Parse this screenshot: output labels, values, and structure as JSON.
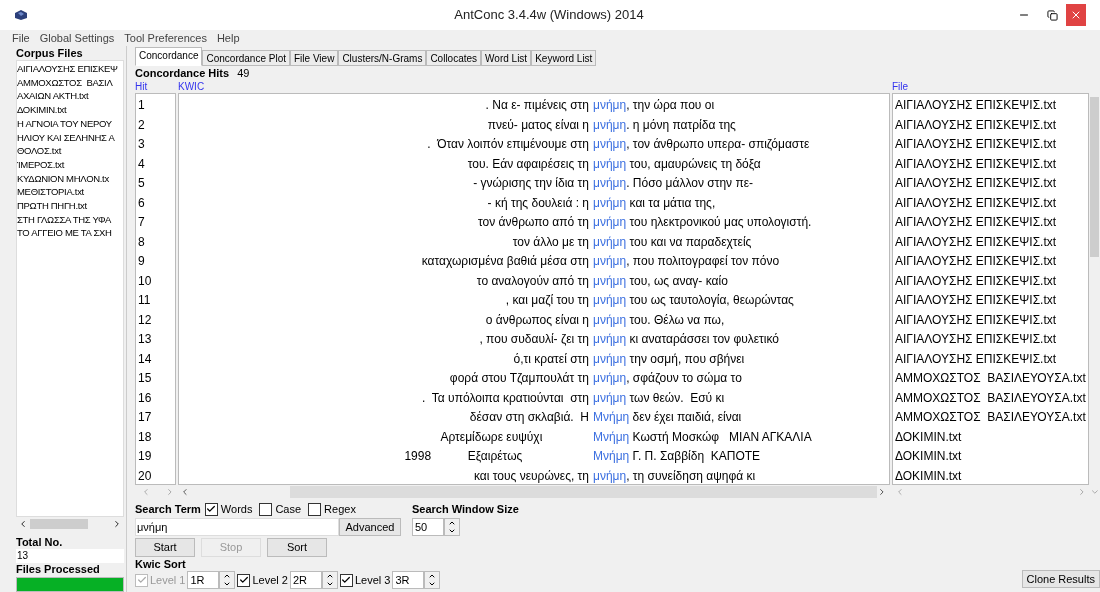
{
  "window": {
    "title": "AntConc 3.4.4w (Windows) 2014"
  },
  "menu": [
    "File",
    "Global Settings",
    "Tool Preferences",
    "Help"
  ],
  "corpus_files": {
    "label": "Corpus Files",
    "items": [
      "ΑΙΓΙΑΛΟΥΣΗΣ ΕΠΙΣΚΕΨ",
      "ΑΜΜΟΧΩΣΤΟΣ  ΒΑΣΙΛ",
      "ΑΧΑΙΩΝ ΑΚΤΗ.txt",
      "ΔΟΚΙΜΙΝ.txt",
      "Η ΑΓΝΟΙΑ ΤΟΥ ΝΕΡΟΥ",
      "ΗΛΙΟΥ ΚΑΙ ΣΕΛΗΝΗΣ Α",
      "ΘΟΛΟΣ.txt",
      "ΊΜΕΡΟΣ.txt",
      "ΚΥΔΩΝΙΟΝ ΜΗΛΟΝ.tx",
      "ΜΕΘΙΣΤΟΡΙΑ.txt",
      "ΠΡΩΤΗ ΠΗΓΗ.txt",
      "ΣΤΗ ΓΛΩΣΣΑ ΤΗΣ ΥΦΑ",
      "ΤΟ ΑΓΓΕΙΟ ΜΕ ΤΑ ΣΧΗ"
    ],
    "total_label": "Total No.",
    "total": "13",
    "processed_label": "Files Processed",
    "processed": {
      "level": 1
    }
  },
  "tabs": [
    {
      "label": "Concordance",
      "selected": true
    },
    {
      "label": "Concordance Plot",
      "selected": false
    },
    {
      "label": "File View",
      "selected": false
    },
    {
      "label": "Clusters/N-Grams",
      "selected": false
    },
    {
      "label": "Collocates",
      "selected": false
    },
    {
      "label": "Word List",
      "selected": false
    },
    {
      "label": "Keyword List",
      "selected": false
    }
  ],
  "hits": {
    "label": "Concordance Hits",
    "value": "49"
  },
  "columns": [
    "Hit",
    "KWIC",
    "File"
  ],
  "rows": [
    {
      "hit": "1",
      "left": ". Να ε- πιμένεις στη",
      "keyword": "μνήμη",
      "right": ", την ώρα που οι",
      "file": "ΑΙΓΙΑΛΟΥΣΗΣ ΕΠΙΣΚΕΨΙΣ.txt"
    },
    {
      "hit": "2",
      "left": "πνεύ- ματος είναι η",
      "keyword": "μνήμη",
      "right": ". η μόνη πατρίδα της",
      "file": "ΑΙΓΙΑΛΟΥΣΗΣ ΕΠΙΣΚΕΨΙΣ.txt"
    },
    {
      "hit": "3",
      "left": ".  Όταν λοιπόν επιμένουμε στη",
      "keyword": "μνήμη",
      "right": ", τον άνθρωπο υπερα- σπιζόμαστε",
      "file": "ΑΙΓΙΑΛΟΥΣΗΣ ΕΠΙΣΚΕΨΙΣ.txt"
    },
    {
      "hit": "4",
      "left": "του. Εάν αφαιρέσεις τη",
      "keyword": "μνήμη",
      "right": " του, αμαυρώνεις τη δόξα",
      "file": "ΑΙΓΙΑΛΟΥΣΗΣ ΕΠΙΣΚΕΨΙΣ.txt"
    },
    {
      "hit": "5",
      "left": "- γνώρισης την ίδια τη",
      "keyword": "μνήμη",
      "right": ". Πόσο μάλλον στην πε-",
      "file": "ΑΙΓΙΑΛΟΥΣΗΣ ΕΠΙΣΚΕΨΙΣ.txt"
    },
    {
      "hit": "6",
      "left": "- κή της δουλειά : η",
      "keyword": "μνήμη",
      "right": " και τα μάτια της,",
      "file": "ΑΙΓΙΑΛΟΥΣΗΣ ΕΠΙΣΚΕΨΙΣ.txt"
    },
    {
      "hit": "7",
      "left": "τον άνθρωπο από τη",
      "keyword": "μνήμη",
      "right": " του ηλεκτρονικού μας υπολογιστή.",
      "file": "ΑΙΓΙΑΛΟΥΣΗΣ ΕΠΙΣΚΕΨΙΣ.txt"
    },
    {
      "hit": "8",
      "left": "τον άλλο με τη",
      "keyword": "μνήμη",
      "right": " του και να παραδεχτείς",
      "file": "ΑΙΓΙΑΛΟΥΣΗΣ ΕΠΙΣΚΕΨΙΣ.txt"
    },
    {
      "hit": "9",
      "left": "καταχωρισμένα βαθιά μέσα στη",
      "keyword": "μνήμη",
      "right": ", που πολιτογραφεί τον πόνο",
      "file": "ΑΙΓΙΑΛΟΥΣΗΣ ΕΠΙΣΚΕΨΙΣ.txt"
    },
    {
      "hit": "10",
      "left": "το αναλογούν από τη",
      "keyword": "μνήμη",
      "right": " του, ως αναγ- καίο",
      "file": "ΑΙΓΙΑΛΟΥΣΗΣ ΕΠΙΣΚΕΨΙΣ.txt"
    },
    {
      "hit": "11",
      "left": ", και μαζί του τη",
      "keyword": "μνήμη",
      "right": " του ως ταυτολογία, θεωρώντας",
      "file": "ΑΙΓΙΑΛΟΥΣΗΣ ΕΠΙΣΚΕΨΙΣ.txt"
    },
    {
      "hit": "12",
      "left": "ο άνθρωπος είναι η",
      "keyword": "μνήμη",
      "right": " του. Θέλω να πω,",
      "file": "ΑΙΓΙΑΛΟΥΣΗΣ ΕΠΙΣΚΕΨΙΣ.txt"
    },
    {
      "hit": "13",
      "left": ", που συδαυλί- ζει τη",
      "keyword": "μνήμη",
      "right": " κι αναταράσσει τον φυλετικό",
      "file": "ΑΙΓΙΑΛΟΥΣΗΣ ΕΠΙΣΚΕΨΙΣ.txt"
    },
    {
      "hit": "14",
      "left": "ό,τι κρατεί στη",
      "keyword": "μνήμη",
      "right": " την οσμή, που σβήνει",
      "file": "ΑΙΓΙΑΛΟΥΣΗΣ ΕΠΙΣΚΕΨΙΣ.txt"
    },
    {
      "hit": "15",
      "left": "φορά στου Τζαμπουλάτ τη",
      "keyword": "μνήμη",
      "right": ", σφάζουν το σώμα το",
      "file": "ΑΜΜΟΧΩΣΤΟΣ  ΒΑΣΙΛΕΥΟΥΣΑ.txt"
    },
    {
      "hit": "16",
      "left": ".  Τα υπόλοιπα κρατιούνται  στη",
      "keyword": "μνήμη",
      "right": " των θεών.  Εσύ κι",
      "file": "ΑΜΜΟΧΩΣΤΟΣ  ΒΑΣΙΛΕΥΟΥΣΑ.txt"
    },
    {
      "hit": "17",
      "left": "δέσαν στη σκλαβιά.  Η",
      "keyword": "Μνήμη",
      "right": " δεν έχει παιδιά, είναι",
      "file": "ΑΜΜΟΧΩΣΤΟΣ  ΒΑΣΙΛΕΥΟΥΣΑ.txt"
    },
    {
      "hit": "18",
      "left": "Αρτεμίδωρε ευψύχι              ",
      "keyword": "Μνήμη",
      "right": " Κωστή Μοσκώφ   ΜΙΑΝ ΑΓΚΑΛΙΑ",
      "file": "ΔΟΚΙΜΙΝ.txt"
    },
    {
      "hit": "19",
      "left": "1998           Εξαιρέτως                    ",
      "keyword": "Μνήμη",
      "right": " Γ. Π. Σαββίδη  ΚΑΠΟΤΕ",
      "file": "ΔΟΚΙΜΙΝ.txt"
    },
    {
      "hit": "20",
      "left": "και τους νευρώνες, τη",
      "keyword": "μνήμη",
      "right": ", τη συνείδηση αψηφά κι",
      "file": "ΔΟΚΙΜΙΝ.txt"
    }
  ],
  "search": {
    "label": "Search Term",
    "options": [
      {
        "label": "Words",
        "checked": true
      },
      {
        "label": "Case",
        "checked": false
      },
      {
        "label": "Regex",
        "checked": false
      }
    ],
    "value": "μνήμη",
    "advanced": "Advanced"
  },
  "window_size": {
    "label": "Search Window Size",
    "value": "50"
  },
  "buttons": [
    {
      "label": "Start",
      "disabled": false
    },
    {
      "label": "Stop",
      "disabled": true
    },
    {
      "label": "Sort",
      "disabled": false
    }
  ],
  "kwic_sort": {
    "label": "Kwic Sort",
    "levels": [
      {
        "label": "Level 1",
        "checked": true,
        "disabled": true,
        "value": "1R"
      },
      {
        "label": "Level 2",
        "checked": true,
        "disabled": false,
        "value": "2R"
      },
      {
        "label": "Level 3",
        "checked": true,
        "disabled": false,
        "value": "3R"
      }
    ]
  },
  "clone": "Clone Results"
}
